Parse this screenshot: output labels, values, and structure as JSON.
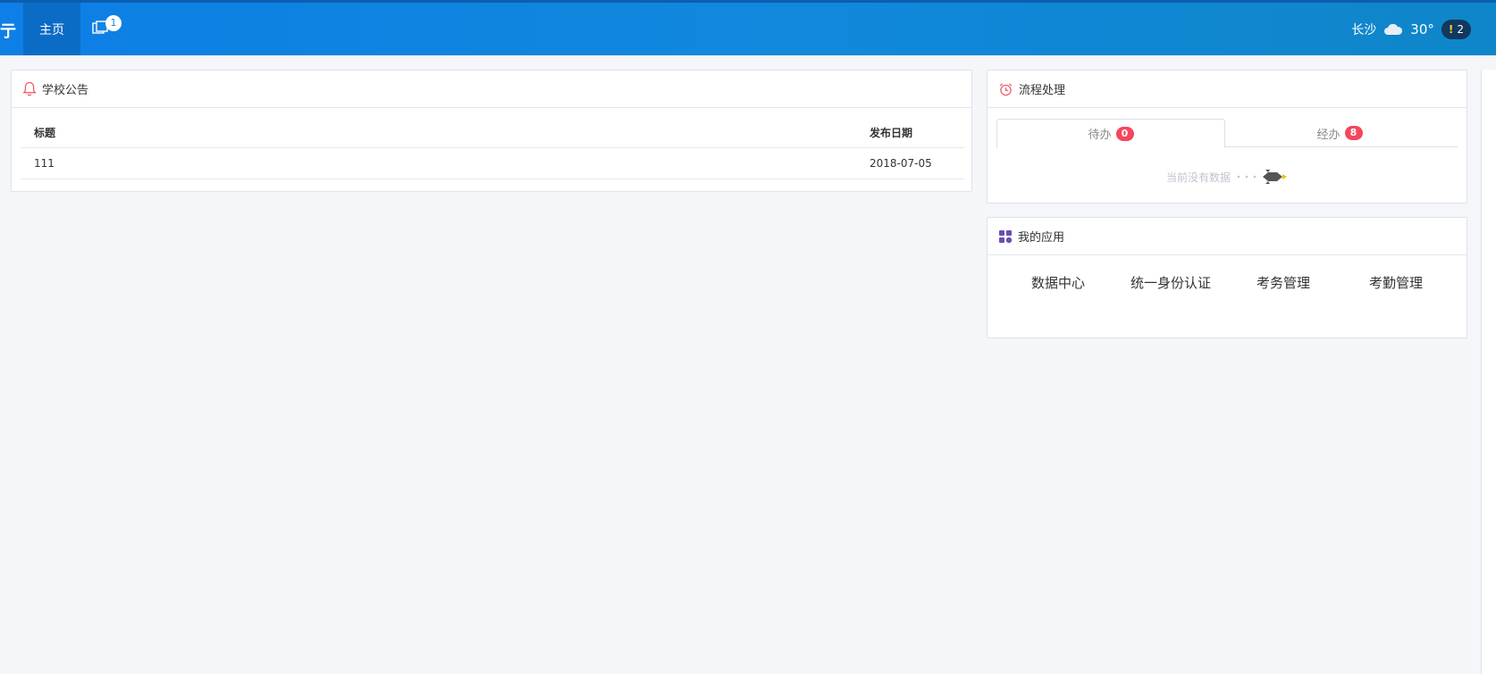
{
  "topbar": {
    "brand_fragment": "亍",
    "home_label": "主页",
    "window_badge": "1",
    "city": "长沙",
    "temperature": "30°",
    "alert_count": "2",
    "weather_icon": "cloud-icon"
  },
  "notice": {
    "title": "学校公告",
    "icon": "bell-icon",
    "columns": {
      "title": "标题",
      "date": "发布日期"
    },
    "rows": [
      {
        "title": "111",
        "date": "2018-07-05"
      }
    ]
  },
  "workflow": {
    "title": "流程处理",
    "icon": "alarm-clock-icon",
    "tabs": [
      {
        "label": "待办",
        "count": "0"
      },
      {
        "label": "经办",
        "count": "8"
      }
    ],
    "empty_text": "当前没有数据",
    "empty_icon": "rocket-icon"
  },
  "apps": {
    "title": "我的应用",
    "icon": "apps-grid-icon",
    "items": [
      "数据中心",
      "统一身份认证",
      "考务管理",
      "考勤管理"
    ]
  },
  "colors": {
    "topbar": "#0d7fe6",
    "badge_red": "#f4475c",
    "bell_red": "#f25d6e",
    "apps_purple": "#6a4fb0"
  }
}
